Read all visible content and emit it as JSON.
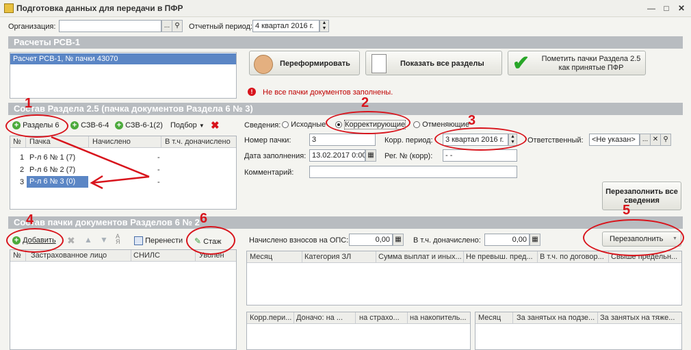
{
  "window": {
    "title": "Подготовка данных для передачи в ПФР"
  },
  "top": {
    "org_label": "Организация:",
    "org_value": "",
    "period_label": "Отчетный период:",
    "period_value": "4 квартал 2016 г."
  },
  "rsv": {
    "section_title": "Расчеты РСВ-1",
    "list_item": "Расчет РСВ-1, № пачки 43070",
    "btn_reform": "Переформировать",
    "btn_show_all": "Показать все разделы",
    "btn_mark_accepted": "Пометить пачки Раздела 2.5 как принятые ПФР",
    "warning": "Не все пачки документов заполнены."
  },
  "section25": {
    "title": "Состав Раздела 2.5     (пачка документов Раздела 6 № 3)",
    "tb_razdely": "Разделы 6",
    "tb_szv64": "СЗВ-6-4",
    "tb_szv61": "СЗВ-6-1(2)",
    "tb_podbor": "Подбор",
    "grid_headers": [
      "№",
      "Пачка",
      "Начислено",
      "В т.ч. доначислено"
    ],
    "rows": [
      {
        "n": "1",
        "pack": "Р-л 6 № 1 (7)",
        "nach": "",
        "donach": "-"
      },
      {
        "n": "2",
        "pack": "Р-л 6 № 2 (7)",
        "nach": "",
        "donach": "-"
      },
      {
        "n": "3",
        "pack": "Р-л 6 № 3 (0)",
        "nach": "",
        "donach": "-"
      }
    ]
  },
  "details": {
    "svedenia_label": "Сведения:",
    "radio_ishodnye": "Исходные",
    "radio_korr": "Корректирующие",
    "radio_otmen": "Отменяющие",
    "nomer_label": "Номер пачки:",
    "nomer_value": "3",
    "korr_label": "Корр. период:",
    "korr_value": "3 квартал 2016 г.",
    "otv_label": "Ответственный:",
    "otv_value": "<Не указан>",
    "date_label": "Дата заполнения:",
    "date_value": "13.02.2017 0:00",
    "reg_label": "Рег. № (корр):",
    "reg_value": "-   -",
    "comment_label": "Комментарий:",
    "comment_value": "",
    "btn_refill_all": "Перезаполнить все сведения"
  },
  "sectionPacks": {
    "title": "Состав пачки документов Разделов 6 № 2",
    "tb_add": "Добавить",
    "tb_move": "Перенести",
    "tb_stazh": "Стаж",
    "grid_headers": [
      "№",
      "Застрахованное лицо",
      "СНИЛС",
      "Уволен"
    ],
    "ops_label": "Начислено взносов на ОПС:",
    "ops_value": "0,00",
    "donach_label": "В т.ч. доначислено:",
    "donach_value": "0,00",
    "btn_refill": "Перезаполнить",
    "grid2_headers": [
      "Месяц",
      "Категория ЗЛ",
      "Сумма выплат и иных...",
      "Не превыш. пред...",
      "В т.ч. по договор...",
      "Свыше предельн..."
    ],
    "grid3_headers": [
      "Корр.пери...",
      "Доначо: на ...",
      "на страхо...",
      "на накопитель..."
    ],
    "grid4_headers": [
      "Месяц",
      "За занятых на подзе...",
      "За занятых на тяже..."
    ]
  },
  "annotations": {
    "n1": "1",
    "n2": "2",
    "n3": "3",
    "n4": "4",
    "n5": "5",
    "n6": "6"
  },
  "colors": {
    "annotation": "#d8141c",
    "section_bar": "#b8bcc0",
    "selection": "#5b86c5"
  }
}
